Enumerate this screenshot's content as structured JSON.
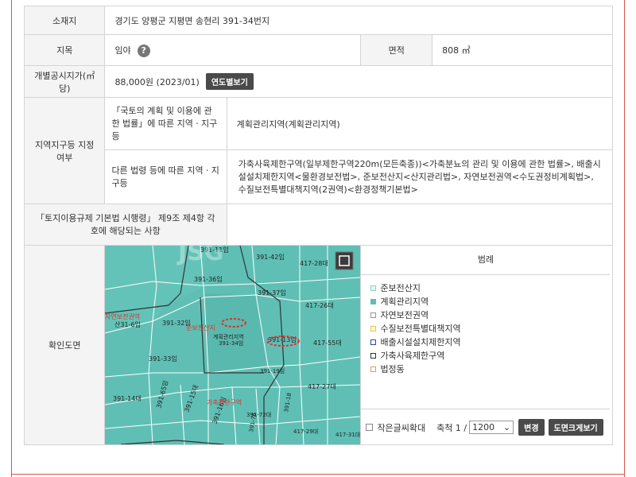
{
  "rows": {
    "location": {
      "label": "소재지",
      "value": "경기도 양평군 지평면 송현리 391-34번지"
    },
    "land_category": {
      "label": "지목",
      "value": "임야",
      "help_icon": "question-circle-icon"
    },
    "area": {
      "label": "면적",
      "value": "808 ㎡"
    },
    "official_price": {
      "label": "개별공시지가(㎡당)",
      "value": "88,000원 (2023/01)",
      "button": "연도별보기"
    },
    "zoning": {
      "label": "지역지구등 지정여부",
      "national_law": {
        "label": "「국토의 계획 및 이용에 관한 법률」에 따른 지역ㆍ지구등",
        "value": "계획관리지역(계획관리지역)"
      },
      "other_law": {
        "label": "다른 법령 등에 따른 지역ㆍ지구등",
        "value": "가축사육제한구역(일부제한구역220m(모든축종))<가축분뇨의 관리 및 이용에 관한 법률>, 배출시설설치제한지역<물환경보전법>, 준보전산지<산지관리법>, 자연보전권역<수도권정비계획법>, 수질보전특별대책지역(2권역)<환경정책기본법>"
      }
    },
    "enforcement": {
      "label": "「토지이용규제 기본법 시행령」 제9조 제4항 각 호에 해당되는 사항",
      "value": ""
    },
    "map": {
      "label": "확인도면"
    }
  },
  "map": {
    "parcel_labels": [
      "391-11임",
      "391-42임",
      "417-28대",
      "391-36임",
      "391-37임",
      "417-26대",
      "391-32임",
      "391-34임",
      "391-13임",
      "417-55대",
      "391-33임",
      "391-19임",
      "417-27대",
      "391-14대",
      "391-65임",
      "391-15대",
      "391-16임",
      "391-72대",
      "417-29대",
      "417-31대",
      "391-76",
      "391-18",
      "산31-6임"
    ],
    "zone_labels": [
      "자연보전권역",
      "준보전산지",
      "계획관리지역",
      "가축제한구역"
    ],
    "watermark": "JSG"
  },
  "legend": {
    "title": "범례",
    "items": [
      {
        "label": "준보전산지",
        "color": "#e8f6f4"
      },
      {
        "label": "계획관리지역",
        "color": "#5fbfb5"
      },
      {
        "label": "자연보전권역",
        "color": "#ffffff"
      },
      {
        "label": "수질보전특별대책지역",
        "color": "#fff6cc"
      },
      {
        "label": "배출시설설치제한지역",
        "color": "#ffffff",
        "border": "#3344aa"
      },
      {
        "label": "가축사육제한구역",
        "color": "#ffffff",
        "border": "#333333"
      },
      {
        "label": "법정동",
        "color": "#ffffff",
        "border": "#c9a26b"
      }
    ]
  },
  "controls": {
    "enlarge_label": "작은글씨확대",
    "scale_label": "축척 1 /",
    "scale_value": "1200",
    "change_button": "변경",
    "large_map_button": "도면크게보기"
  }
}
